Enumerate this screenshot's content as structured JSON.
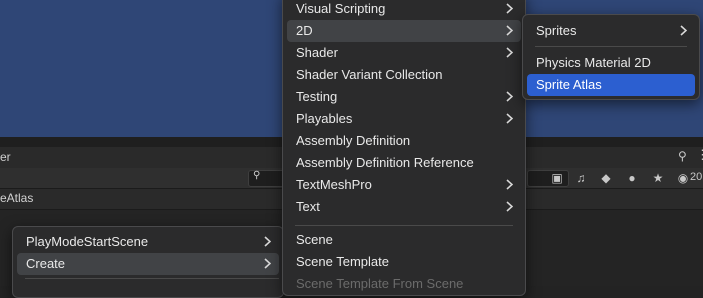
{
  "panel": {
    "title_fragment": "er",
    "breadcrumb_fragment": "eAtlas",
    "toolbar_count": "20"
  },
  "context_menu": {
    "items": [
      {
        "label": "PlayModeStartScene",
        "has_submenu": true
      },
      {
        "label": "Create",
        "has_submenu": true
      }
    ]
  },
  "create_menu": {
    "items": [
      {
        "label": "Visual Scripting",
        "has_submenu": true
      },
      {
        "label": "2D",
        "has_submenu": true
      },
      {
        "label": "Shader",
        "has_submenu": true
      },
      {
        "label": "Shader Variant Collection",
        "has_submenu": false
      },
      {
        "label": "Testing",
        "has_submenu": true
      },
      {
        "label": "Playables",
        "has_submenu": true
      },
      {
        "label": "Assembly Definition",
        "has_submenu": false
      },
      {
        "label": "Assembly Definition Reference",
        "has_submenu": false
      },
      {
        "label": "TextMeshPro",
        "has_submenu": true
      },
      {
        "label": "Text",
        "has_submenu": true
      },
      {
        "label": "Scene",
        "has_submenu": false
      },
      {
        "label": "Scene Template",
        "has_submenu": false
      },
      {
        "label": "Scene Template From Scene",
        "has_submenu": false
      }
    ]
  },
  "submenu_2d": {
    "items": [
      {
        "label": "Sprites",
        "has_submenu": true
      },
      {
        "label": "Physics Material 2D",
        "has_submenu": false
      },
      {
        "label": "Sprite Atlas",
        "has_submenu": false
      }
    ]
  },
  "colors": {
    "scene_background": "#2f4676",
    "menu_background": "#2b2b2c",
    "menu_highlight": "#414346",
    "selection_accent": "#2c5fd0"
  },
  "icons": {
    "search": "search-icon",
    "lock": "lock-icon",
    "more": "more-menu-icon",
    "toolbar": [
      "asset-type-filter-icon",
      "audio-filter-icon",
      "label-filter-icon",
      "error-filter-icon",
      "favorite-star-icon",
      "visibility-hidden-icon"
    ]
  }
}
